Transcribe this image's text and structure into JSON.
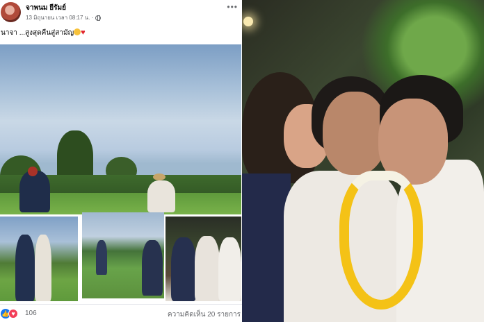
{
  "post": {
    "author": "จาพนม ยีรัมย์",
    "timestamp": "13 มิถุนายน เวลา 08:17 น. ·",
    "caption": "นาจา ...สูงสุดคืนสู่สามัญ",
    "reaction_count": "106",
    "comments_label": "ความคิดเห็น 20 รายการ"
  },
  "icons": {
    "privacy": "globe-icon",
    "more": "more-options-icon",
    "like": "like-reaction-icon",
    "love": "love-reaction-icon"
  },
  "colors": {
    "like": "#1877f2",
    "love": "#f33e58",
    "heart_emoji": "#e0242c"
  }
}
